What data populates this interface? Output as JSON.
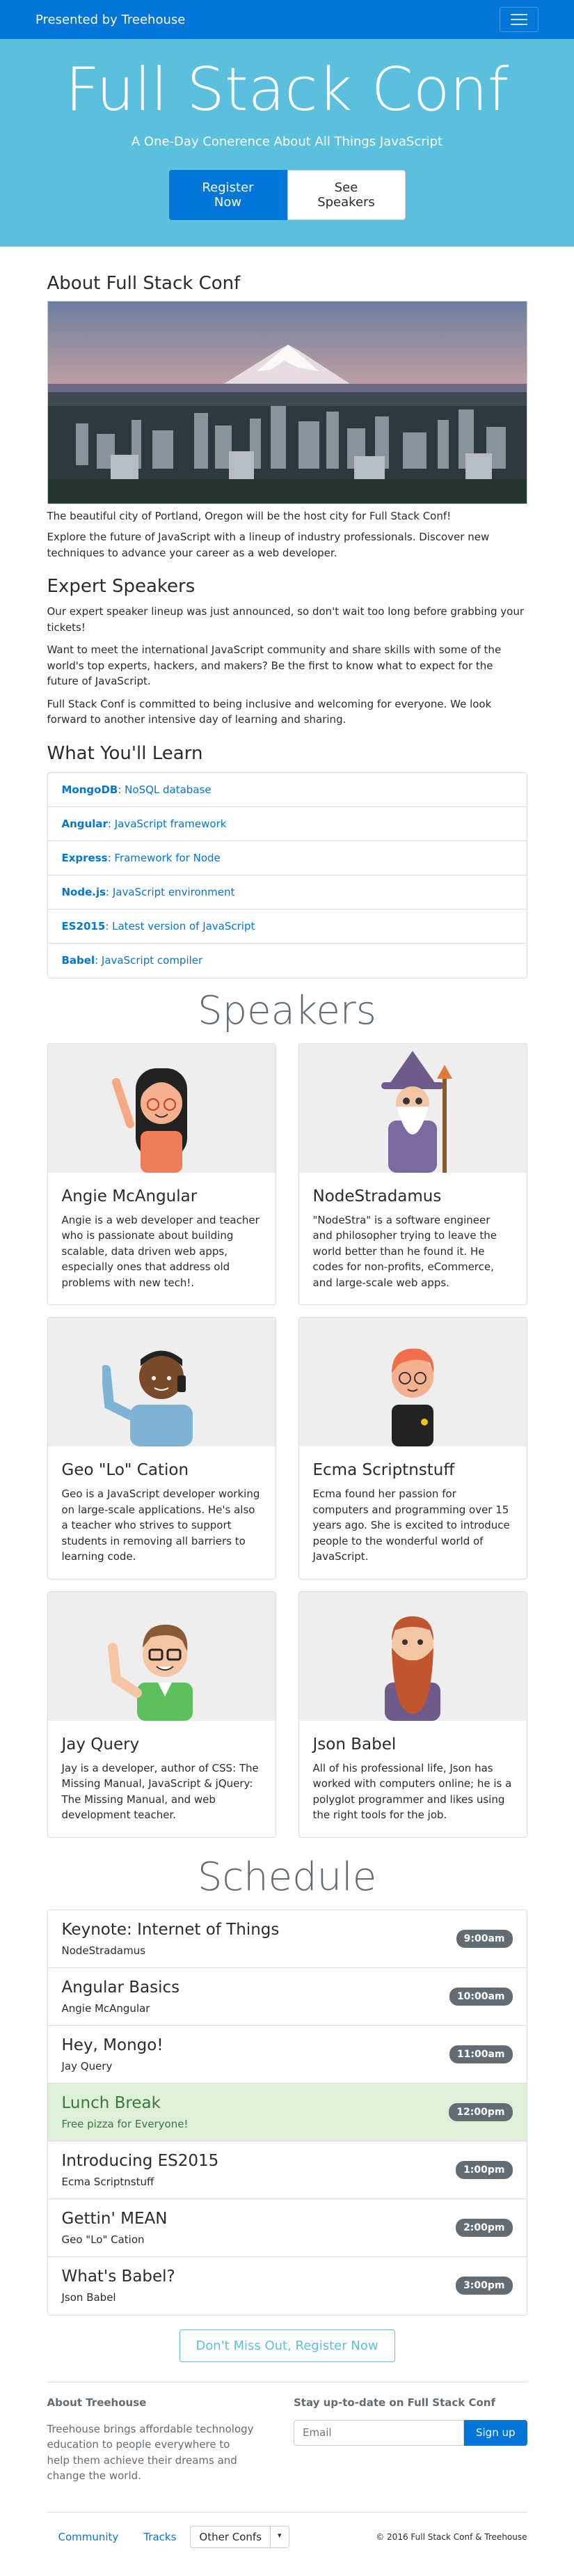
{
  "navbar": {
    "brand": "Presented by Treehouse"
  },
  "hero": {
    "title": "Full Stack Conf",
    "tagline": "A One-Day Conerence About All Things JavaScript",
    "register_label": "Register Now",
    "speakers_label": "See Speakers"
  },
  "about": {
    "heading": "About Full Stack Conf",
    "caption": "The beautiful city of Portland, Oregon will be the host city for Full Stack Conf!",
    "text": "Explore the future of JavaScript with a lineup of industry professionals. Discover new techniques to advance your career as a web developer."
  },
  "expert": {
    "heading": "Expert Speakers",
    "p1": "Our expert speaker lineup was just announced, so don't wait too long before grabbing your tickets!",
    "p2": "Want to meet the international JavaScript community and share skills with some of the world's top experts, hackers, and makers? Be the first to know what to expect for the future of JavaScript.",
    "p3": "Full Stack Conf is committed to being inclusive and welcoming for everyone. We look forward to another intensive day of learning and sharing."
  },
  "learn": {
    "heading": "What You'll Learn",
    "items": [
      {
        "name": "MongoDB",
        "desc": ": NoSQL database"
      },
      {
        "name": "Angular",
        "desc": ": JavaScript framework"
      },
      {
        "name": "Express",
        "desc": ": Framework for Node"
      },
      {
        "name": "Node.js",
        "desc": ": JavaScript environment"
      },
      {
        "name": "ES2015",
        "desc": ": Latest version of JavaScript"
      },
      {
        "name": "Babel",
        "desc": ": JavaScript compiler"
      }
    ]
  },
  "speakers": {
    "heading": "Speakers",
    "items": [
      {
        "name": "Angie McAngular",
        "bio": "Angie is a web developer and teacher who is passionate about building scalable, data driven web apps, especially ones that address old problems with new tech!."
      },
      {
        "name": "NodeStradamus",
        "bio": "\"NodeStra\" is a software engineer and philosopher trying to leave the world better than he found it. He codes for non-profits, eCommerce, and large-scale web apps."
      },
      {
        "name": "Geo \"Lo\" Cation",
        "bio": "Geo is a JavaScript developer working on large-scale applications. He's also a teacher who strives to support students in removing all barriers to learning code."
      },
      {
        "name": "Ecma Scriptnstuff",
        "bio": "Ecma found her passion for computers and programming over 15 years ago. She is excited to introduce people to the wonderful world of JavaScript."
      },
      {
        "name": "Jay Query",
        "bio": "Jay is a developer, author of CSS: The Missing Manual, JavaScript & jQuery: The Missing Manual, and web development teacher."
      },
      {
        "name": "Json Babel",
        "bio": "All of his professional life, Json has worked with computers online; he is a polyglot programmer and likes using the right tools for the job."
      }
    ]
  },
  "schedule": {
    "heading": "Schedule",
    "items": [
      {
        "title": "Keynote: Internet of Things",
        "speaker": "NodeStradamus",
        "time": "9:00am"
      },
      {
        "title": "Angular Basics",
        "speaker": "Angie McAngular",
        "time": "10:00am"
      },
      {
        "title": "Hey, Mongo!",
        "speaker": "Jay Query",
        "time": "11:00am"
      },
      {
        "title": "Lunch Break",
        "speaker": "Free pizza for Everyone!",
        "time": "12:00pm"
      },
      {
        "title": "Introducing ES2015",
        "speaker": "Ecma Scriptnstuff",
        "time": "1:00pm"
      },
      {
        "title": "Gettin' MEAN",
        "speaker": "Geo \"Lo\" Cation",
        "time": "2:00pm"
      },
      {
        "title": "What's Babel?",
        "speaker": "Json Babel",
        "time": "3:00pm"
      }
    ],
    "cta": "Don't Miss Out, Register Now"
  },
  "footer": {
    "about_heading": "About Treehouse",
    "about_text": "Treehouse brings affordable technology education to people everywhere to help them achieve their dreams and change the world.",
    "signup_heading": "Stay up-to-date on Full Stack Conf",
    "email_placeholder": "Email",
    "signup_label": "Sign up",
    "links": [
      "Community",
      "Tracks"
    ],
    "dropdown_label": "Other Confs",
    "copyright": "© 2016 Full Stack Conf & Treehouse"
  },
  "colors": {
    "primary": "#0275d8",
    "info": "#5bc0de",
    "success_bg": "#dff0d8",
    "badge": "#636c72"
  }
}
